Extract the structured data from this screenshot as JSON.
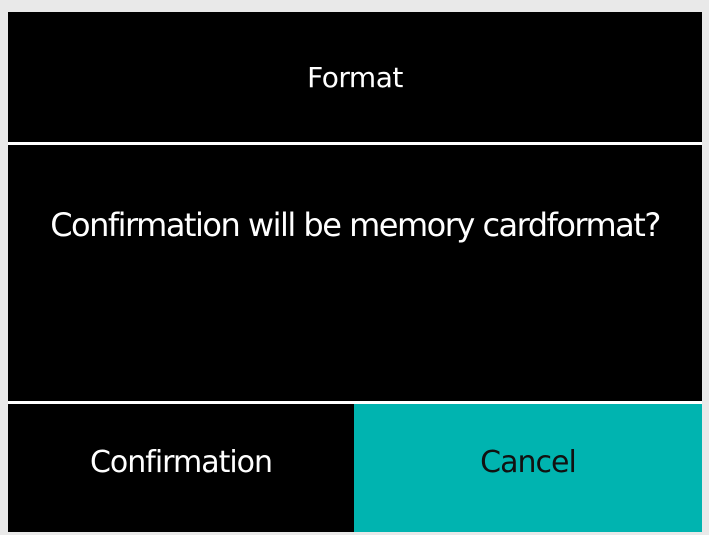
{
  "dialog": {
    "title": "Format",
    "message": "Confirmation will be memory cardformat?"
  },
  "buttons": {
    "confirm_label": "Confirmation",
    "cancel_label": "Cancel"
  },
  "colors": {
    "background": "#000000",
    "text": "#ffffff",
    "selected_button": "#00b4b0",
    "divider": "#ffffff"
  }
}
